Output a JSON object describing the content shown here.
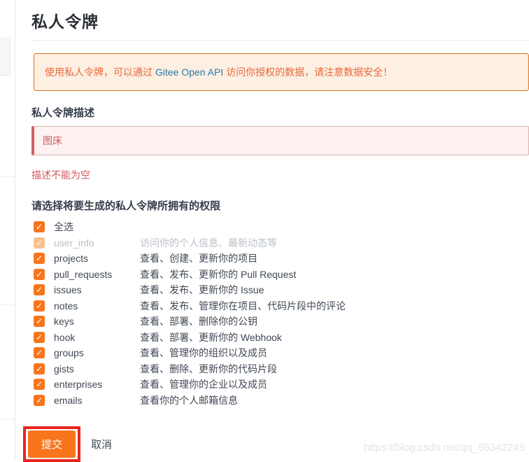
{
  "page": {
    "title": "私人令牌",
    "watermark": "https://blog.csdn.net/qq_55342245"
  },
  "banner": {
    "text_before": "使用私人令牌，可以通过 ",
    "link_text": "Gitee Open API",
    "text_after": " 访问你授权的数据，请注意数据安全！"
  },
  "form": {
    "description_label": "私人令牌描述",
    "description_value": "图床",
    "error_message": "描述不能为空"
  },
  "permissions": {
    "heading": "请选择将要生成的私人令牌所拥有的权限",
    "items": [
      {
        "label": "全选",
        "desc": "",
        "checked": true,
        "disabled": false
      },
      {
        "label": "user_info",
        "desc": "访问你的个人信息、最新动态等",
        "checked": true,
        "disabled": true
      },
      {
        "label": "projects",
        "desc": "查看、创建、更新你的项目",
        "checked": true,
        "disabled": false
      },
      {
        "label": "pull_requests",
        "desc": "查看、发布、更新你的 Pull Request",
        "checked": true,
        "disabled": false
      },
      {
        "label": "issues",
        "desc": "查看、发布、更新你的 Issue",
        "checked": true,
        "disabled": false
      },
      {
        "label": "notes",
        "desc": "查看、发布、管理你在项目、代码片段中的评论",
        "checked": true,
        "disabled": false
      },
      {
        "label": "keys",
        "desc": "查看、部署、删除你的公钥",
        "checked": true,
        "disabled": false
      },
      {
        "label": "hook",
        "desc": "查看、部署、更新你的 Webhook",
        "checked": true,
        "disabled": false
      },
      {
        "label": "groups",
        "desc": "查看、管理你的组织以及成员",
        "checked": true,
        "disabled": false
      },
      {
        "label": "gists",
        "desc": "查看、删除、更新你的代码片段",
        "checked": true,
        "disabled": false
      },
      {
        "label": "enterprises",
        "desc": "查看、管理你的企业以及成员",
        "checked": true,
        "disabled": false
      },
      {
        "label": "emails",
        "desc": "查看你的个人邮箱信息",
        "checked": true,
        "disabled": false
      }
    ]
  },
  "actions": {
    "submit_label": "提交",
    "cancel_label": "取消"
  },
  "icons": {
    "check": "✓"
  },
  "colors": {
    "accent_orange": "#f8751c",
    "banner_background": "#fdefe2",
    "banner_border": "#e0731c",
    "banner_text": "#e8683a",
    "link_blue": "#2b7cab",
    "error_red": "#d05a5a",
    "input_background": "#fdf1f1",
    "input_border": "#dcb2b2",
    "input_left_border": "#ce6060",
    "annotation_red": "#e8251d",
    "disabled_checkbox": "#f9c28f",
    "disabled_text": "#b9bec6"
  }
}
